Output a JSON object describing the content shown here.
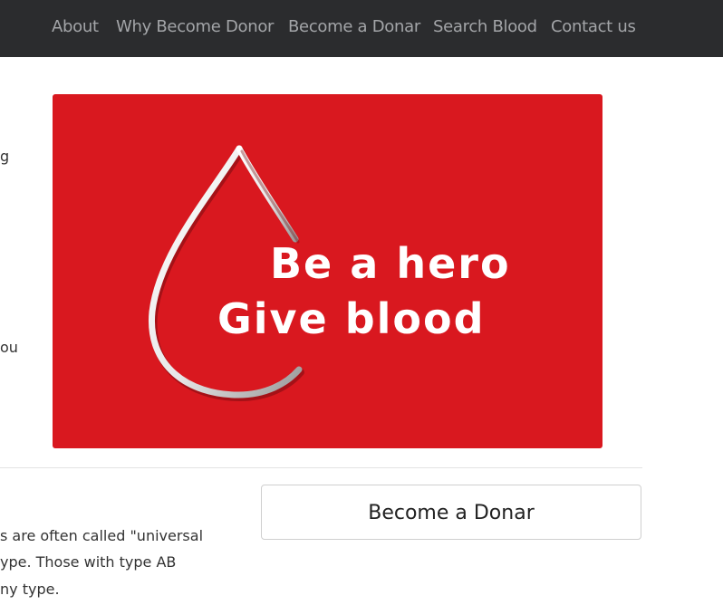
{
  "nav": {
    "items": [
      {
        "label": "About"
      },
      {
        "label": "Why Become Donor"
      },
      {
        "label": "Become a Donar"
      },
      {
        "label": "Search Blood"
      },
      {
        "label": "Contact us"
      }
    ]
  },
  "left_fragments": {
    "line1": "g",
    "line2": "ou"
  },
  "hero": {
    "line1": "Be a hero",
    "line2": "Give blood",
    "background_color": "#d9181f"
  },
  "cta": {
    "label": "Become a Donar"
  },
  "paragraph": {
    "lines": [
      "s are often called \"universal",
      "ype. Those with type AB",
      "ny type."
    ]
  }
}
